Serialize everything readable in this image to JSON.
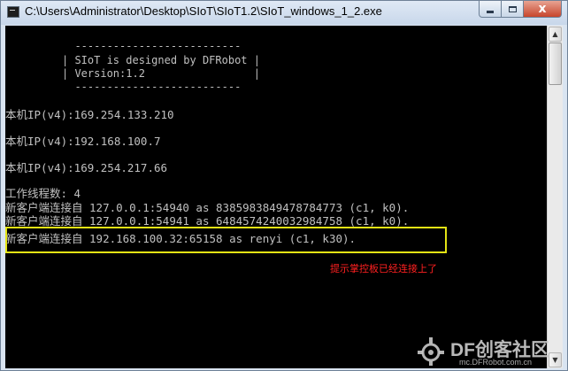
{
  "window": {
    "title": "C:\\Users\\Administrator\\Desktop\\SIoT\\SIoT1.2\\SIoT_windows_1_2.exe",
    "controls": {
      "minimize_icon": "minimize-icon",
      "maximize_icon": "maximize-icon",
      "close_icon": "close-icon",
      "close_glyph": "x"
    }
  },
  "console": {
    "banner": [
      "  --------------------------",
      "| SIoT is designed by DFRobot |",
      "| Version:1.2                 |",
      "  --------------------------"
    ],
    "lines": [
      "本机IP(v4):169.254.133.210",
      "本机IP(v4):192.168.100.7",
      "本机IP(v4):169.254.217.66",
      "工作线程数: 4",
      "新客户端连接自 127.0.0.1:54940 as 8385983849478784773 (c1, k0).",
      "新客户端连接自 127.0.0.1:54941 as 6484574240032984758 (c1, k0).",
      "新客户端连接自 192.168.100.32:65158 as renyi (c1, k30)."
    ],
    "colors": {
      "background": "#000000",
      "text": "#c0c0c0",
      "highlight_border": "#e3e314",
      "annotation": "#ff2020"
    }
  },
  "annotation": {
    "text": "提示掌控板已经连接上了"
  },
  "watermark": {
    "brand": "DF创客社区",
    "url": "mc.DFRobot.com.cn",
    "logo_icon": "df-logo-icon"
  }
}
